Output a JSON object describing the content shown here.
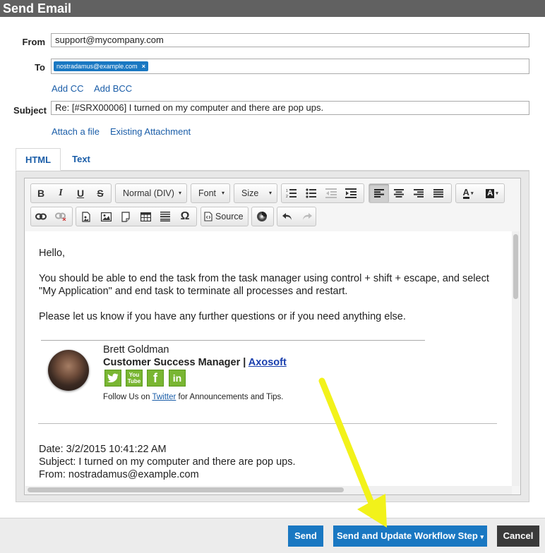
{
  "window": {
    "title": "Send Email"
  },
  "form": {
    "from_label": "From",
    "from_value": "support@mycompany.com",
    "to_label": "To",
    "to_recipient": "nostradamus@example.com",
    "to_recipient_remove": "×",
    "add_cc": "Add CC",
    "add_bcc": "Add BCC",
    "subject_label": "Subject",
    "subject_value": "Re: [#SRX00006] I turned on my computer and there are pop ups.",
    "attach_file": "Attach a file",
    "existing_attachment": "Existing Attachment"
  },
  "tabs": [
    {
      "label": "HTML",
      "active": true
    },
    {
      "label": "Text",
      "active": false
    }
  ],
  "toolbar": {
    "bold": "B",
    "italic": "I",
    "underline": "U",
    "strike": "S",
    "format_combo": "Normal (DIV)",
    "font_combo": "Font",
    "size_combo": "Size",
    "source": "Source",
    "combo_arrow": "▾",
    "text_color": "A",
    "bg_color": "A",
    "special_char": "Ω"
  },
  "body": {
    "greeting": "Hello,",
    "para1_line1": "You should be able to end the task from the task manager using control + shift + escape, and select",
    "para1_line2": "\"My Application\" and end task to terminate all processes and restart.",
    "para2": "Please let us know if you have any further questions or if you need anything else.",
    "signature": {
      "name": "Brett Goldman",
      "role": "Customer Success Manager | ",
      "company_link": "Axosoft",
      "follow_prefix": "Follow Us on ",
      "follow_link": "Twitter",
      "follow_suffix": " for Announcements and Tips.",
      "social_icons": [
        "twitter-icon",
        "youtube-icon",
        "facebook-icon",
        "linkedin-icon"
      ],
      "youtube_text_top": "You",
      "youtube_text_bottom": "Tube",
      "facebook_letter": "f",
      "linkedin_text": "in"
    },
    "quoted": {
      "date": "Date: 3/2/2015 10:41:22 AM",
      "subject": "Subject: I turned on my computer and there are pop ups.",
      "from": "From: nostradamus@example.com"
    }
  },
  "buttons": {
    "send": "Send",
    "send_update": "Send and Update Workflow Step",
    "send_update_caret": "▾",
    "cancel": "Cancel"
  },
  "colors": {
    "accent": "#1a78c2",
    "link": "#1a5da8",
    "titlebar": "#616161",
    "cancel": "#3a3a3a",
    "social": "#79b632",
    "annotation_arrow": "#f2f21a"
  }
}
